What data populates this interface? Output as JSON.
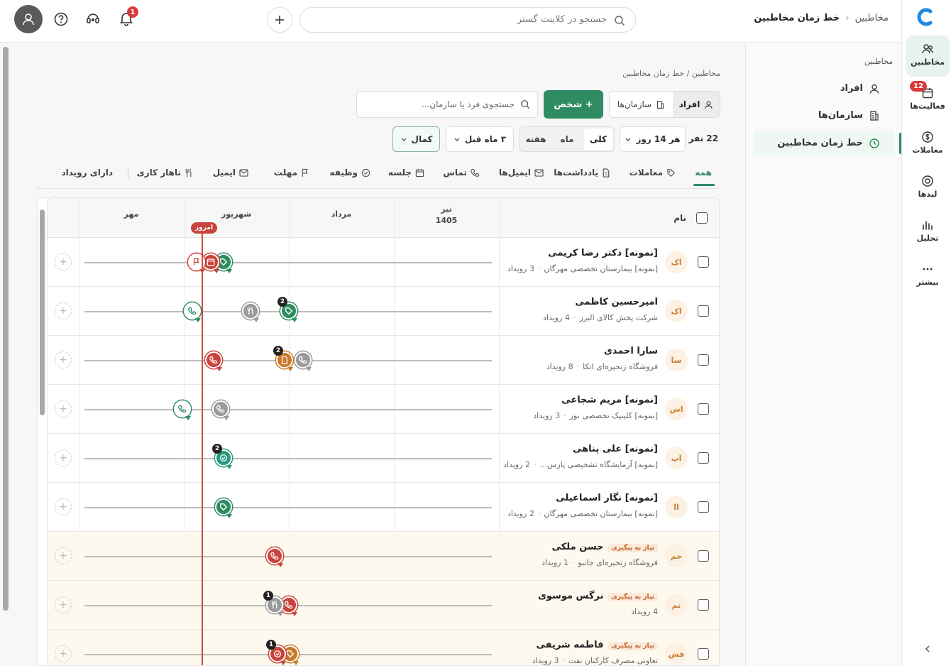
{
  "rail": {
    "items": [
      {
        "label": "مخاطبین",
        "icon": "users-icon",
        "active": true
      },
      {
        "label": "فعالیت‌ها",
        "icon": "calendar-icon",
        "badge": "12"
      },
      {
        "label": "معاملات",
        "icon": "dollar-icon"
      },
      {
        "label": "لیدها",
        "icon": "target-icon"
      },
      {
        "label": "تحلیل",
        "icon": "chart-icon"
      },
      {
        "label": "بیشتر",
        "icon": "more-icon"
      }
    ]
  },
  "topbar": {
    "breadcrumb_root": "مخاطبین",
    "breadcrumb_current": "خط زمان مخاطبین",
    "search_placeholder": "جستجو در کلاینت گستر",
    "notif_count": "1"
  },
  "sidepanel": {
    "section_title": "مخاطبین",
    "items": [
      {
        "label": "افراد",
        "icon": "person-icon"
      },
      {
        "label": "سازمان‌ها",
        "icon": "building-icon"
      },
      {
        "label": "خط زمان مخاطبین",
        "icon": "clock-icon",
        "active": true
      }
    ]
  },
  "main": {
    "breadcrumb": "مخاطبین / خط زمان مخاطبین",
    "seg_people": "افراد",
    "seg_orgs": "سازمان‌ها",
    "add_person": "+ شخص",
    "search_placeholder": "جستجوی فرد یا سازمان...",
    "count_label": "22 نفر",
    "interval": "هر 14 روز",
    "range_all": "کلی",
    "range_month": "ماه",
    "range_week": "هفته",
    "period": "۳ ماه قبل",
    "density": "کمال"
  },
  "tabs": [
    "همه",
    "معاملات",
    "یادداشت‌ها",
    "ایمیل‌ها",
    "تماس",
    "جلسه",
    "وظیفه",
    "مهلت",
    "ایمیل",
    "ناهار کاری",
    "دارای رویداد"
  ],
  "grid": {
    "name_header": "نام",
    "months": [
      {
        "name": "تیر",
        "year": "1405"
      },
      {
        "name": "مرداد"
      },
      {
        "name": "شهریور"
      },
      {
        "name": "مهر"
      }
    ],
    "today_label": "امروز"
  },
  "rows": [
    {
      "initials": "اک",
      "name": "[نمونه] دکتر رضا کریمی",
      "org": "[نمونه] بیمارستان تخصصی مهرگان",
      "events": "3 رویداد"
    },
    {
      "initials": "اک",
      "name": "امیرحسین کاظمی",
      "org": "شرکت پخش کالای البرز",
      "events": "4 رویداد"
    },
    {
      "initials": "سا",
      "name": "سارا احمدی",
      "org": "فروشگاه زنجیره‌ای اتکا",
      "events": "8 رویداد"
    },
    {
      "initials": "اش",
      "name": "[نمونه] مریم شجاعی",
      "org": "[نمونه] کلینیک تخصصی نور",
      "events": "3 رویداد"
    },
    {
      "initials": "اپ",
      "name": "[نمونه] علی پناهی",
      "org": "[نمونه] آزمایشگاه تشخیصی پارس...",
      "events": "2 رویداد"
    },
    {
      "initials": "اا",
      "name": "[نمونه] نگار اسماعیلی",
      "org": "[نمونه] بیمارستان تخصصی مهرگان",
      "events": "2 رویداد"
    },
    {
      "initials": "حم",
      "name": "حسن ملکی",
      "tag": "نیاز به پیگیری",
      "org": "فروشگاه زنجیره‌ای جانبو",
      "events": "1 رویداد"
    },
    {
      "initials": "نم",
      "name": "نرگس موسوی",
      "tag": "نیاز به پیگیری",
      "org": "",
      "events": "4 رویداد"
    },
    {
      "initials": "فش",
      "name": "فاطمه شریفی",
      "tag": "نیاز به پیگیری",
      "org": "تعاونی مصرف کارکنان نفت",
      "events": "3 رویداد"
    }
  ],
  "colors": {
    "green": "#2e8b62",
    "red": "#c9443c",
    "orange": "#c87a2a",
    "gray": "#9a9a9a",
    "teal": "#2a9b7e"
  }
}
